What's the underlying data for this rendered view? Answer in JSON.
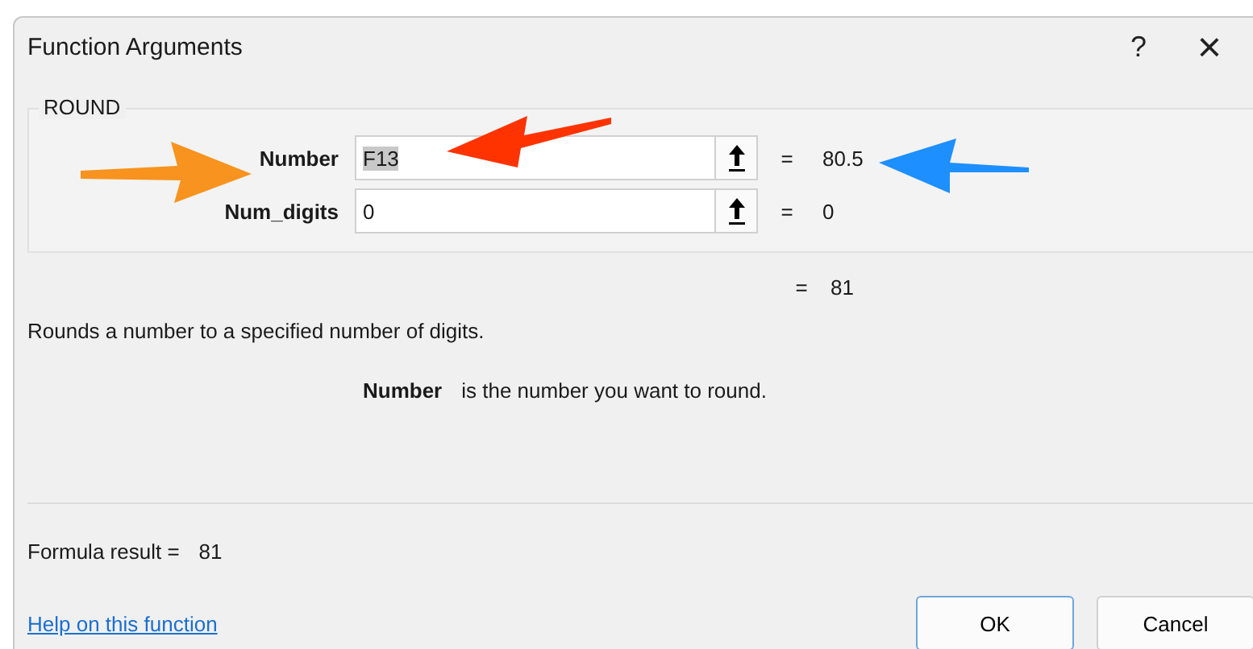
{
  "window": {
    "title": "Function Arguments",
    "help": "?",
    "close": "×"
  },
  "function_name": "ROUND",
  "arguments": [
    {
      "label": "Number",
      "value": "F13",
      "value_selected": true,
      "equals": "=",
      "result": "80.5"
    },
    {
      "label": "Num_digits",
      "value": "0",
      "value_selected": false,
      "equals": "=",
      "result": "0"
    }
  ],
  "function_result": {
    "equals": "=",
    "value": "81"
  },
  "description": "Rounds a number to a specified number of digits.",
  "argument_help": {
    "name": "Number",
    "text": "is the number you want to round."
  },
  "formula_result": {
    "label": "Formula result =",
    "value": "81"
  },
  "help_link": "Help on this function",
  "buttons": [
    {
      "label": "OK",
      "default": true
    },
    {
      "label": "Cancel",
      "default": false
    }
  ],
  "annotations": [
    {
      "kind": "right",
      "color": "#f7931e"
    },
    {
      "kind": "left",
      "color": "#ff3300"
    },
    {
      "kind": "left-flat",
      "color": "#1e8fff"
    }
  ]
}
